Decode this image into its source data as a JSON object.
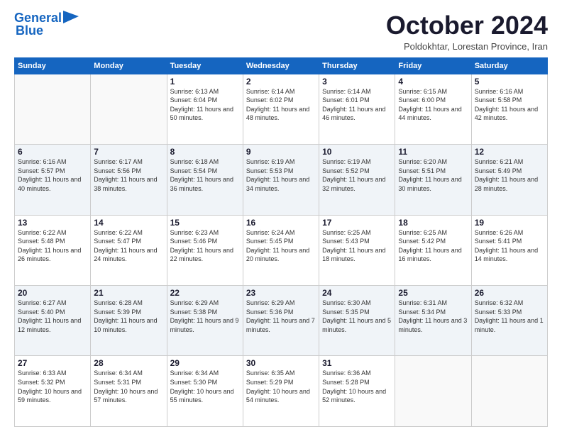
{
  "header": {
    "logo_line1": "General",
    "logo_line2": "Blue",
    "month": "October 2024",
    "location": "Poldokhtar, Lorestan Province, Iran"
  },
  "days_of_week": [
    "Sunday",
    "Monday",
    "Tuesday",
    "Wednesday",
    "Thursday",
    "Friday",
    "Saturday"
  ],
  "weeks": [
    [
      {
        "day": "",
        "info": ""
      },
      {
        "day": "",
        "info": ""
      },
      {
        "day": "1",
        "info": "Sunrise: 6:13 AM\nSunset: 6:04 PM\nDaylight: 11 hours and 50 minutes."
      },
      {
        "day": "2",
        "info": "Sunrise: 6:14 AM\nSunset: 6:02 PM\nDaylight: 11 hours and 48 minutes."
      },
      {
        "day": "3",
        "info": "Sunrise: 6:14 AM\nSunset: 6:01 PM\nDaylight: 11 hours and 46 minutes."
      },
      {
        "day": "4",
        "info": "Sunrise: 6:15 AM\nSunset: 6:00 PM\nDaylight: 11 hours and 44 minutes."
      },
      {
        "day": "5",
        "info": "Sunrise: 6:16 AM\nSunset: 5:58 PM\nDaylight: 11 hours and 42 minutes."
      }
    ],
    [
      {
        "day": "6",
        "info": "Sunrise: 6:16 AM\nSunset: 5:57 PM\nDaylight: 11 hours and 40 minutes."
      },
      {
        "day": "7",
        "info": "Sunrise: 6:17 AM\nSunset: 5:56 PM\nDaylight: 11 hours and 38 minutes."
      },
      {
        "day": "8",
        "info": "Sunrise: 6:18 AM\nSunset: 5:54 PM\nDaylight: 11 hours and 36 minutes."
      },
      {
        "day": "9",
        "info": "Sunrise: 6:19 AM\nSunset: 5:53 PM\nDaylight: 11 hours and 34 minutes."
      },
      {
        "day": "10",
        "info": "Sunrise: 6:19 AM\nSunset: 5:52 PM\nDaylight: 11 hours and 32 minutes."
      },
      {
        "day": "11",
        "info": "Sunrise: 6:20 AM\nSunset: 5:51 PM\nDaylight: 11 hours and 30 minutes."
      },
      {
        "day": "12",
        "info": "Sunrise: 6:21 AM\nSunset: 5:49 PM\nDaylight: 11 hours and 28 minutes."
      }
    ],
    [
      {
        "day": "13",
        "info": "Sunrise: 6:22 AM\nSunset: 5:48 PM\nDaylight: 11 hours and 26 minutes."
      },
      {
        "day": "14",
        "info": "Sunrise: 6:22 AM\nSunset: 5:47 PM\nDaylight: 11 hours and 24 minutes."
      },
      {
        "day": "15",
        "info": "Sunrise: 6:23 AM\nSunset: 5:46 PM\nDaylight: 11 hours and 22 minutes."
      },
      {
        "day": "16",
        "info": "Sunrise: 6:24 AM\nSunset: 5:45 PM\nDaylight: 11 hours and 20 minutes."
      },
      {
        "day": "17",
        "info": "Sunrise: 6:25 AM\nSunset: 5:43 PM\nDaylight: 11 hours and 18 minutes."
      },
      {
        "day": "18",
        "info": "Sunrise: 6:25 AM\nSunset: 5:42 PM\nDaylight: 11 hours and 16 minutes."
      },
      {
        "day": "19",
        "info": "Sunrise: 6:26 AM\nSunset: 5:41 PM\nDaylight: 11 hours and 14 minutes."
      }
    ],
    [
      {
        "day": "20",
        "info": "Sunrise: 6:27 AM\nSunset: 5:40 PM\nDaylight: 11 hours and 12 minutes."
      },
      {
        "day": "21",
        "info": "Sunrise: 6:28 AM\nSunset: 5:39 PM\nDaylight: 11 hours and 10 minutes."
      },
      {
        "day": "22",
        "info": "Sunrise: 6:29 AM\nSunset: 5:38 PM\nDaylight: 11 hours and 9 minutes."
      },
      {
        "day": "23",
        "info": "Sunrise: 6:29 AM\nSunset: 5:36 PM\nDaylight: 11 hours and 7 minutes."
      },
      {
        "day": "24",
        "info": "Sunrise: 6:30 AM\nSunset: 5:35 PM\nDaylight: 11 hours and 5 minutes."
      },
      {
        "day": "25",
        "info": "Sunrise: 6:31 AM\nSunset: 5:34 PM\nDaylight: 11 hours and 3 minutes."
      },
      {
        "day": "26",
        "info": "Sunrise: 6:32 AM\nSunset: 5:33 PM\nDaylight: 11 hours and 1 minute."
      }
    ],
    [
      {
        "day": "27",
        "info": "Sunrise: 6:33 AM\nSunset: 5:32 PM\nDaylight: 10 hours and 59 minutes."
      },
      {
        "day": "28",
        "info": "Sunrise: 6:34 AM\nSunset: 5:31 PM\nDaylight: 10 hours and 57 minutes."
      },
      {
        "day": "29",
        "info": "Sunrise: 6:34 AM\nSunset: 5:30 PM\nDaylight: 10 hours and 55 minutes."
      },
      {
        "day": "30",
        "info": "Sunrise: 6:35 AM\nSunset: 5:29 PM\nDaylight: 10 hours and 54 minutes."
      },
      {
        "day": "31",
        "info": "Sunrise: 6:36 AM\nSunset: 5:28 PM\nDaylight: 10 hours and 52 minutes."
      },
      {
        "day": "",
        "info": ""
      },
      {
        "day": "",
        "info": ""
      }
    ]
  ]
}
